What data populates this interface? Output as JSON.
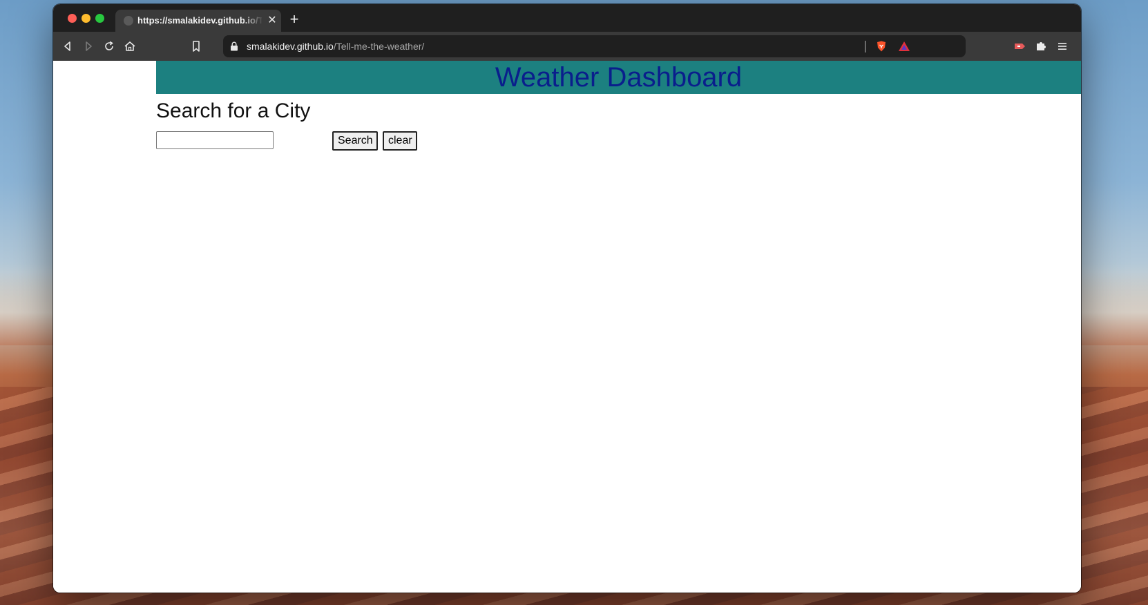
{
  "browser": {
    "tab": {
      "title": "https://smalakidev.github.io/Tell-me-the-weather/"
    },
    "url": {
      "host": "smalakidev.github.io",
      "path": "/Tell-me-the-weather/"
    }
  },
  "page": {
    "header_title": "Weather Dashboard",
    "search_heading": "Search for a City",
    "search_input": {
      "value": "",
      "placeholder": ""
    },
    "search_button_label": "Search",
    "clear_button_label": "clear"
  },
  "colors": {
    "header_bg": "#1c8080",
    "header_text": "#0a1e8c"
  }
}
